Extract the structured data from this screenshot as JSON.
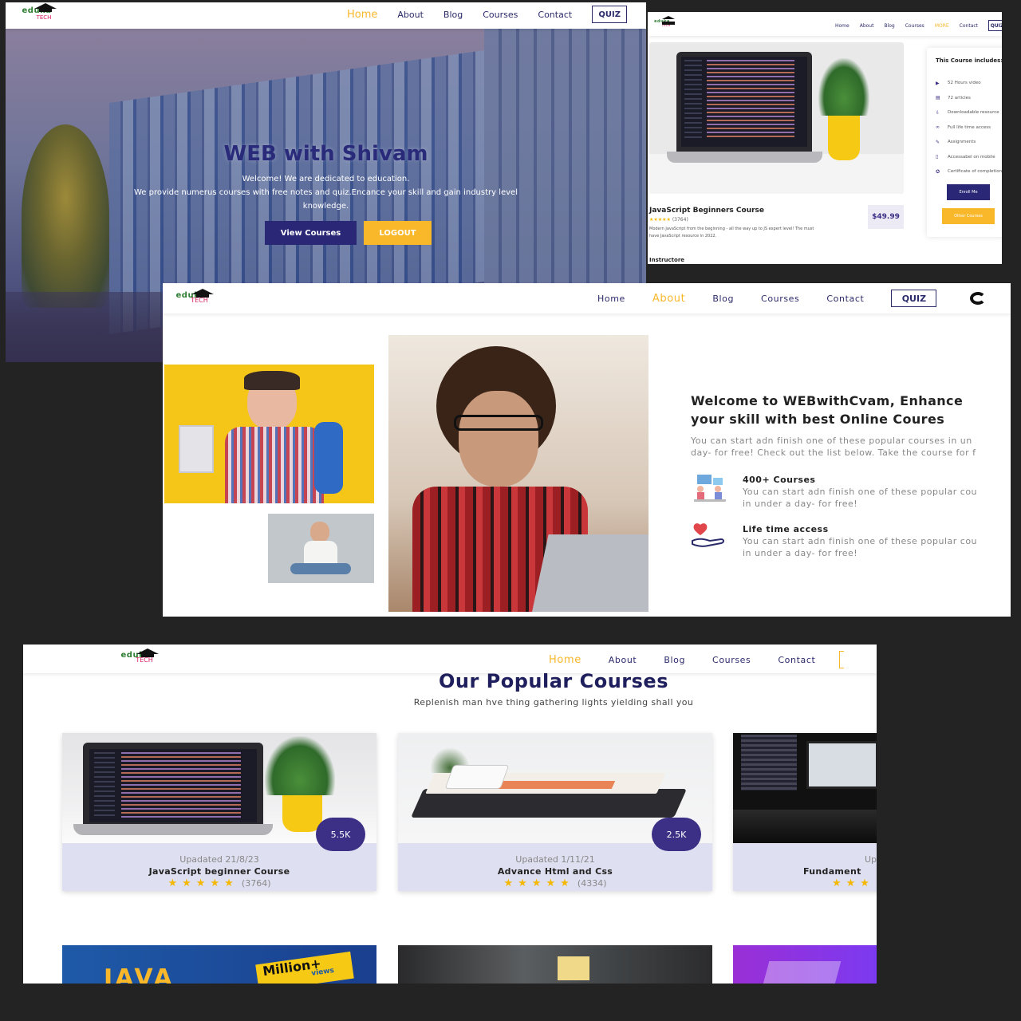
{
  "brand": {
    "line1": "eduka",
    "line2": "TECH"
  },
  "nav": {
    "home": "Home",
    "about": "About",
    "blog": "Blog",
    "courses": "Courses",
    "contact": "Contact",
    "more": "MORE",
    "quiz": "QUIZ"
  },
  "hero": {
    "title": "WEB with Shivam",
    "line1": "Welcome! We are dedicated to education.",
    "line2": "We provide numerus courses with free notes and quiz.Encance your skill and gain industry level",
    "line3": "knowledge.",
    "view_courses": "View Courses",
    "logout": "LOGOUT"
  },
  "course_detail": {
    "title": "JavaScript Beginners Course",
    "stars": "★★★★★",
    "reviews": "(3764)",
    "desc1": "Modern JavaScript from the beginning - all the way up to JS expert level! The must",
    "desc2": "have JavaScript resource in 2022.",
    "instructor_label": "Instructore",
    "price": "$49.99",
    "includes_title": "This Course includes:",
    "includes": [
      {
        "icon": "video-icon",
        "text": "52 Hours video"
      },
      {
        "icon": "article-icon",
        "text": "72 articles"
      },
      {
        "icon": "download-icon",
        "text": "Downloadable resource"
      },
      {
        "icon": "infinity-icon",
        "text": "Full life time access"
      },
      {
        "icon": "assignment-icon",
        "text": "Assignments"
      },
      {
        "icon": "mobile-icon",
        "text": "Accessabel on mobile"
      },
      {
        "icon": "certificate-icon",
        "text": "Certificate of completion"
      }
    ],
    "enroll": "Enroll Me",
    "other": "Other Courses"
  },
  "about": {
    "heading1": "Welcome to WEBwithCvam, Enhance",
    "heading2": "your skill with best Online Coures",
    "para1": "You can start adn finish one of these popular courses in un",
    "para2": "day- for free! Check out the list below. Take the course for f",
    "features": [
      {
        "icon": "students-icon",
        "title": "400+ Courses",
        "line1": "You can start adn finish one of these popular cou",
        "line2": "in under a day- for free!"
      },
      {
        "icon": "heart-hand-icon",
        "title": "Life time access",
        "line1": "You can start adn finish one of these popular cou",
        "line2": "in under a day- for free!"
      }
    ]
  },
  "popular": {
    "title": "Our Popular Courses",
    "subtitle": "Replenish man hve thing gathering lights yielding shall you",
    "cards": [
      {
        "badge": "5.5K",
        "updated": "Upadated 21/8/23",
        "title": "JavaScript beginner Course",
        "stars": "★★★★★",
        "reviews": "(3764)"
      },
      {
        "badge": "2.5K",
        "updated": "Upadated 1/11/21",
        "title": "Advance Html and Css",
        "stars": "★★★★★",
        "reviews": "(4334)"
      },
      {
        "badge": "",
        "updated": "Upada",
        "title": "Fundament",
        "stars": "★★★",
        "reviews": ""
      }
    ],
    "bottom": {
      "java": "JAVA",
      "million": "Million+",
      "views": "views"
    }
  },
  "colors": {
    "accent": "#f9b72a",
    "navy": "#2b2b6b",
    "badge": "#3b2f86",
    "card_bg": "#dedff0"
  }
}
